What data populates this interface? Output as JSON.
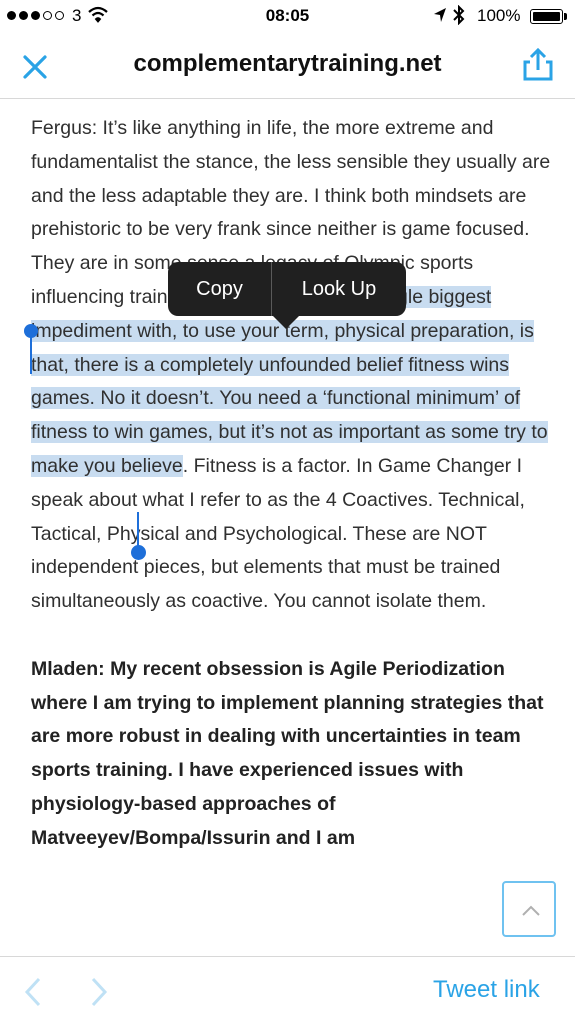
{
  "status_bar": {
    "carrier": "3",
    "time": "08:05",
    "battery": "100%",
    "signal_bars": 3,
    "signal_total": 5
  },
  "nav": {
    "title": "complementarytraining.net",
    "close_icon": "close-icon",
    "share_icon": "share-icon"
  },
  "article": {
    "para1_pre": "Fergus: It’s like anything in life, the more extreme and fundamentalist the stance, the less sensible they usually are and the less adaptable they are. I think both mindsets are prehistoric to be very frank since neither is game focused. They are in some sense a legacy of Olympic sports influencing training of team sports.",
    "para1_selected": "The single biggest impediment with, to use your term, physical preparation, is that, there is a completely unfounded belief fitness wins games. No it doesn’t. You need a ‘functional minimum’ of fitness to win games, but it’s not as important as some try to make you believe",
    "para1_post": ". Fitness is a factor. In Game Changer I speak about what I refer to as the 4 Coactives. Technical, Tactical, Physical and Psychological. These are NOT independent pieces, but elements that must be trained simultaneously as coactive. You cannot isolate them.",
    "para2": "Mladen: My recent obsession is Agile Periodization where I am trying to implement planning strategies that are more robust in dealing with uncertainties in team sports training. I have experienced issues with physiology-based approaches of Matveeyev/Bompa/Issurin and I am"
  },
  "callout": {
    "copy": "Copy",
    "look_up": "Look Up"
  },
  "toolbar": {
    "tweet_link": "Tweet link"
  },
  "colors": {
    "accent": "#2aa3e6",
    "selection": "#c8dcf0",
    "handle": "#1e6fd9"
  }
}
